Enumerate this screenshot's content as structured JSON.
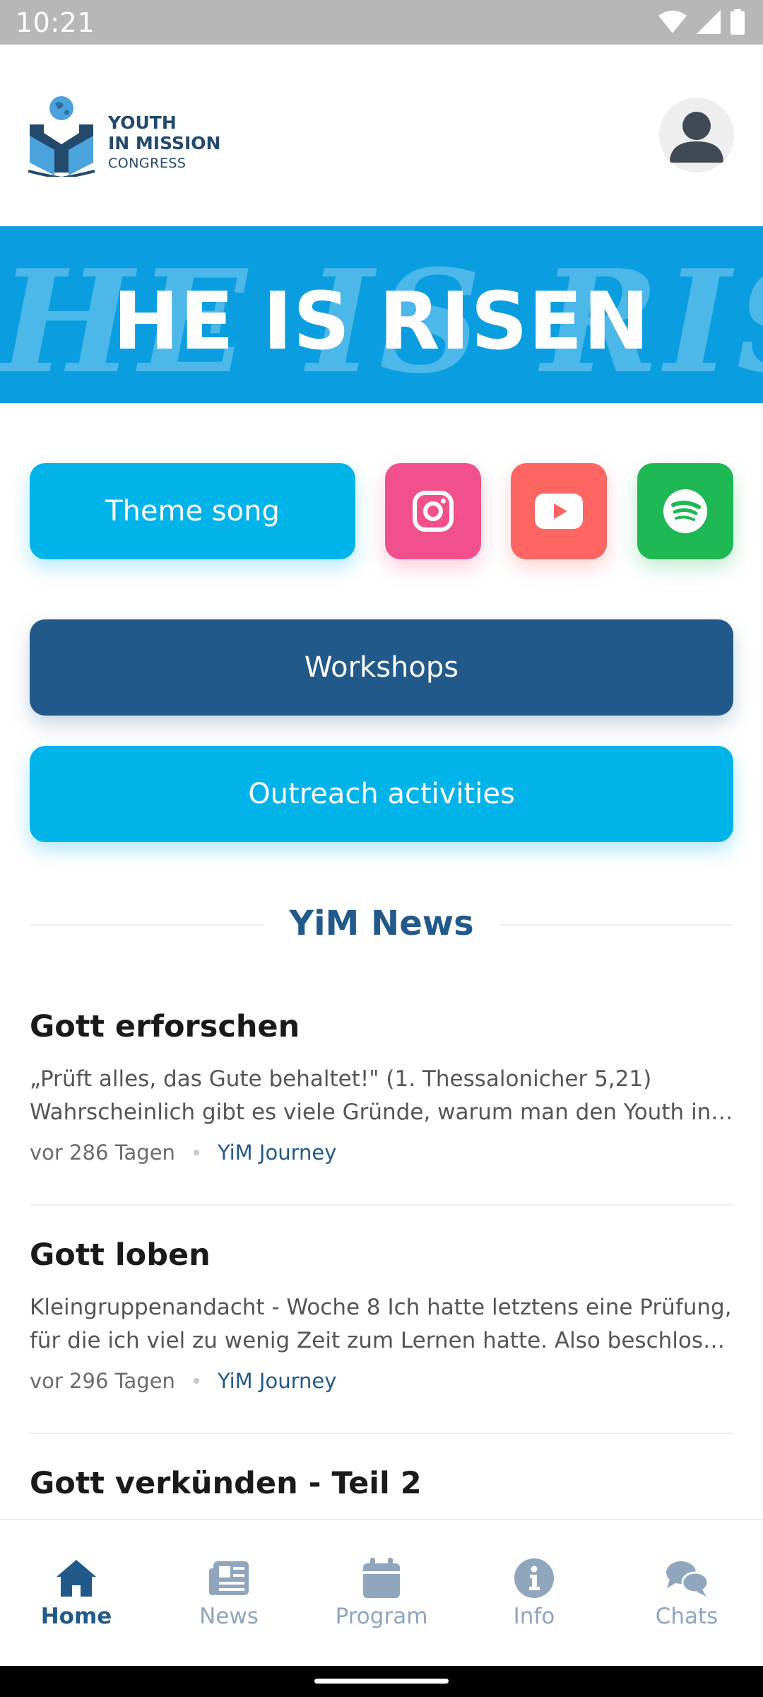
{
  "status_bar": {
    "time": "10:21"
  },
  "header": {
    "logo": {
      "line1": "YOUTH",
      "line2": "IN MISSION",
      "line3": "CONGRESS"
    },
    "avatar_icon": "person-avatar-icon"
  },
  "banner": {
    "headline": "HE IS RISEN"
  },
  "actions": {
    "theme_song": "Theme song",
    "instagram_icon": "instagram-icon",
    "youtube_icon": "youtube-icon",
    "spotify_icon": "spotify-icon",
    "workshops": "Workshops",
    "outreach": "Outreach activities"
  },
  "news": {
    "section_title": "YiM News",
    "articles": [
      {
        "title": "Gott erforschen",
        "excerpt_line1": "„Prüft alles, das Gute behaltet!\" (1. Thessalonicher 5,21)",
        "excerpt_line2": "Wahrscheinlich gibt es viele Gründe, warum man den Youth in …",
        "age": "vor 286 Tagen",
        "source": "YiM Journey"
      },
      {
        "title": "Gott loben",
        "excerpt_line1": "Kleingruppenandacht - Woche 8 Ich hatte letztens eine Prüfung,",
        "excerpt_line2": "für die ich viel zu wenig Zeit zum Lernen hatte. Also beschloss …",
        "age": "vor 296 Tagen",
        "source": "YiM Journey"
      },
      {
        "title": "Gott verkünden - Teil 2"
      }
    ]
  },
  "bottom_nav": {
    "items": [
      {
        "label": "Home",
        "icon": "home-icon",
        "active": true
      },
      {
        "label": "News",
        "icon": "newspaper-icon",
        "active": false
      },
      {
        "label": "Program",
        "icon": "calendar-icon",
        "active": false
      },
      {
        "label": "Info",
        "icon": "info-icon",
        "active": false
      },
      {
        "label": "Chats",
        "icon": "chat-bubbles-icon",
        "active": false
      }
    ]
  },
  "colors": {
    "primary_dark": "#215a8a",
    "primary_light": "#00b4ea",
    "instagram": "#f2508d",
    "youtube": "#ff6661",
    "spotify": "#1eb954",
    "banner": "#0a9ee0"
  }
}
